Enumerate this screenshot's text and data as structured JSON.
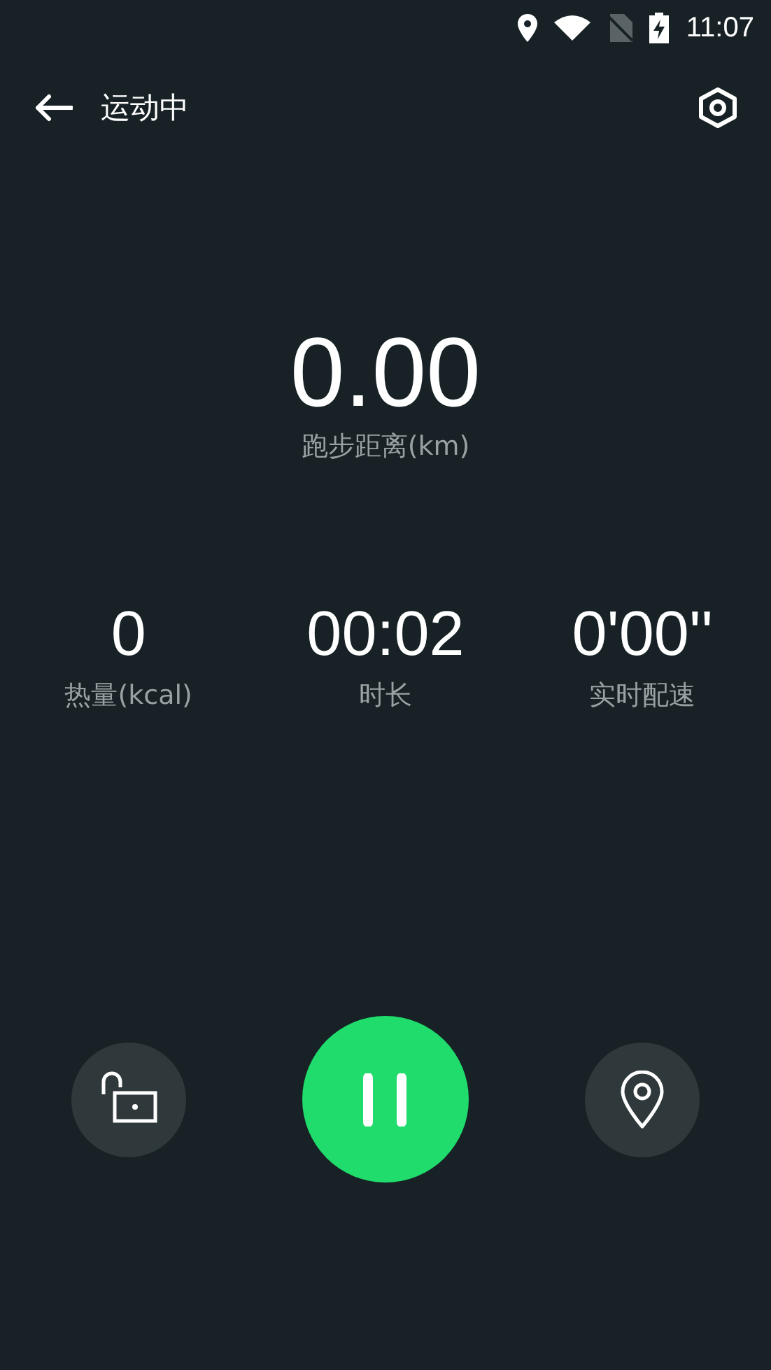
{
  "status_bar": {
    "time": "11:07"
  },
  "header": {
    "title": "运动中"
  },
  "distance": {
    "value": "0.00",
    "label": "跑步距离(km)"
  },
  "stats": [
    {
      "value": "0",
      "label": "热量(kcal)"
    },
    {
      "value": "00:02",
      "label": "时长"
    },
    {
      "value": "0'00''",
      "label": "实时配速"
    }
  ]
}
